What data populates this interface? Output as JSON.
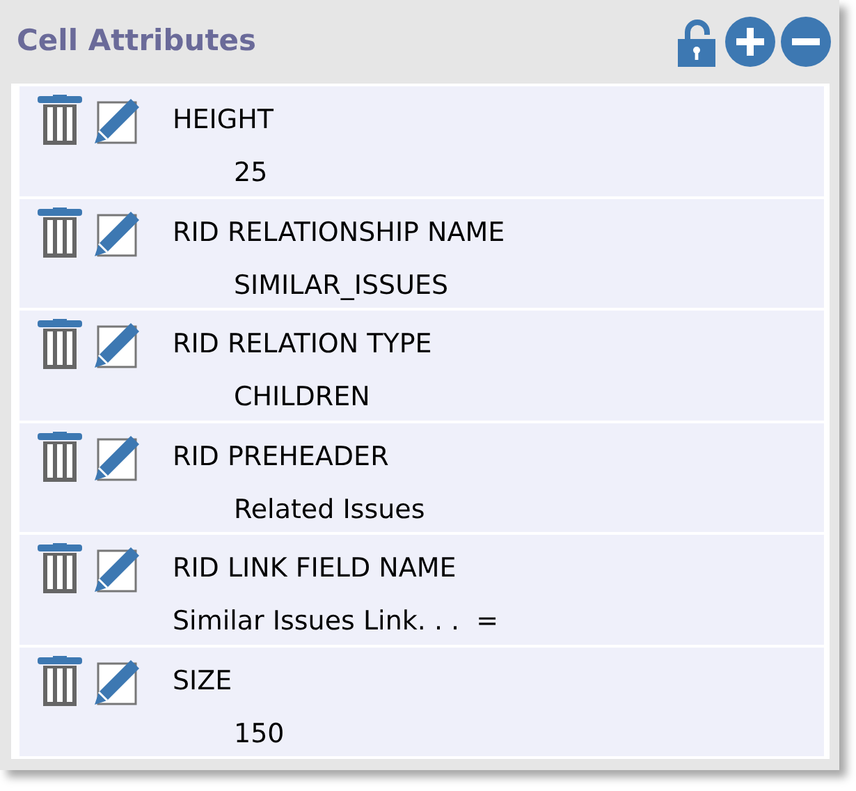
{
  "panel": {
    "title": "Cell Attributes"
  },
  "attributes": [
    {
      "name": "HEIGHT",
      "value": "25",
      "kind": "indented"
    },
    {
      "name": "RID RELATIONSHIP NAME",
      "value": "SIMILAR_ISSUES",
      "kind": "indented"
    },
    {
      "name": "RID RELATION TYPE",
      "value": "CHILDREN",
      "kind": "indented"
    },
    {
      "name": "RID PREHEADER",
      "value": "Related Issues",
      "kind": "indented"
    },
    {
      "name": "RID LINK FIELD NAME",
      "value": "Similar Issues Link. . .  =",
      "kind": "flush"
    },
    {
      "name": "SIZE",
      "value": "150",
      "kind": "indented"
    }
  ]
}
